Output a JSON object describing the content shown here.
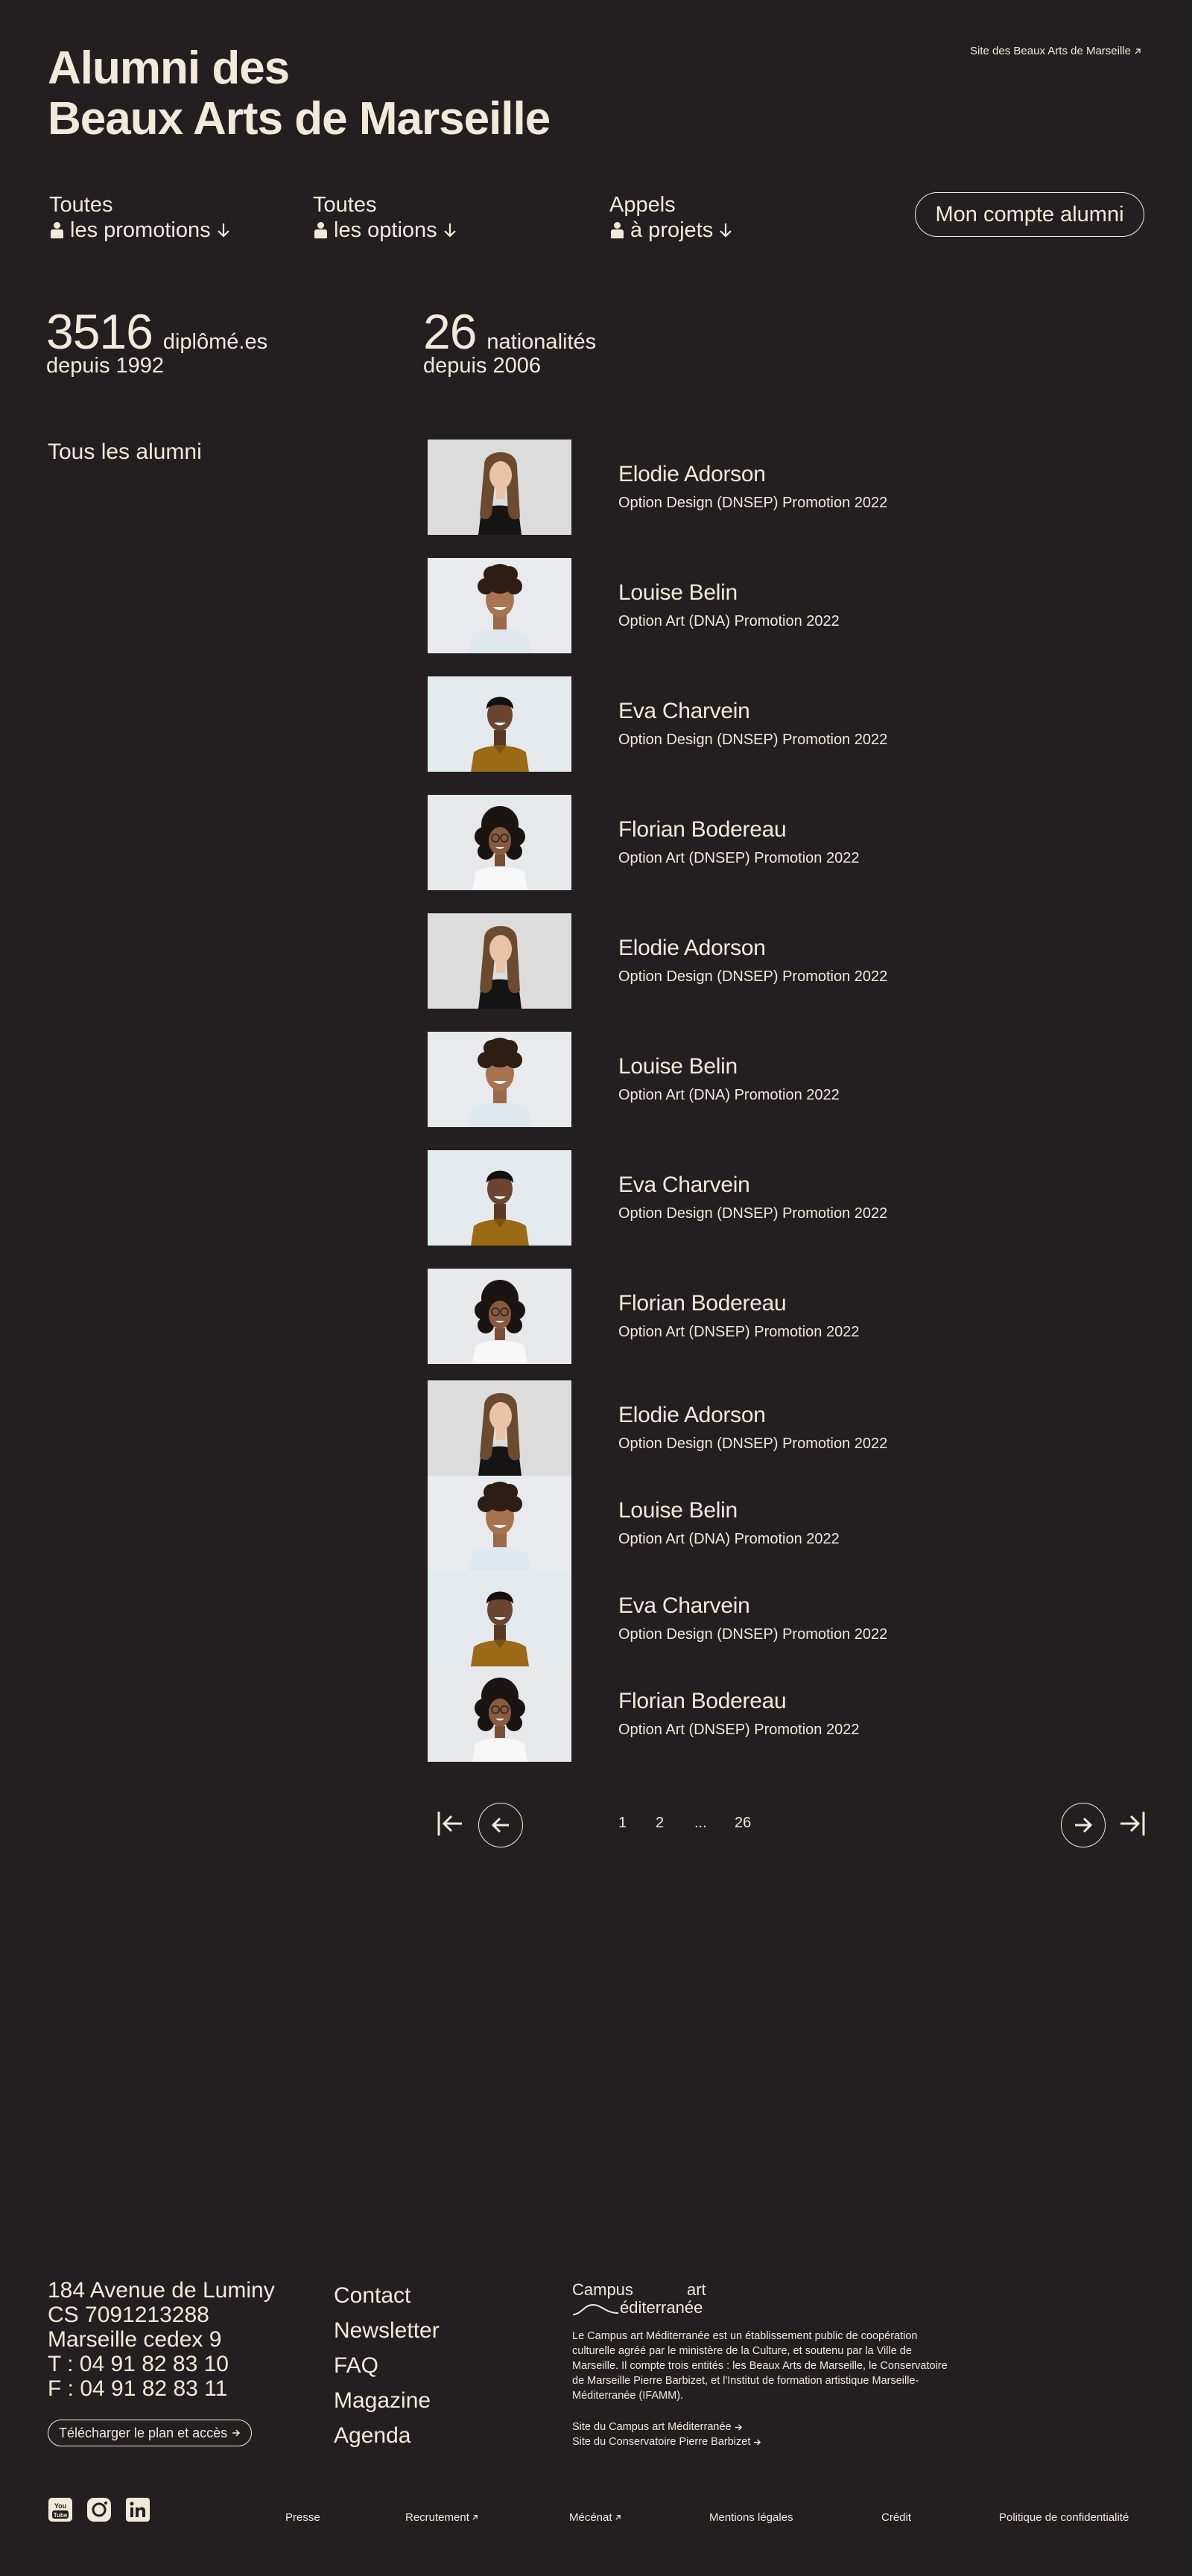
{
  "header": {
    "site_link": "Site des Beaux Arts de Marseille",
    "title_line1": "Alumni des",
    "title_line2": "Beaux Arts de Marseille"
  },
  "filters": [
    {
      "line1": "Toutes",
      "line2": "les promotions"
    },
    {
      "line1": "Toutes",
      "line2": "les options"
    },
    {
      "line1": "Appels",
      "line2": "à projets"
    }
  ],
  "account_button": "Mon compte alumni",
  "stats": [
    {
      "number": "3516",
      "label": "diplômé.es",
      "since": "depuis 1992"
    },
    {
      "number": "26",
      "label": "nationalités",
      "since": "depuis 2006"
    }
  ],
  "section_label": "Tous les alumni",
  "alumni": [
    {
      "name": "Elodie Adorson",
      "info": "Option Design (DNSEP) Promotion 2022",
      "photo": "woman-long-hair"
    },
    {
      "name": "Louise Belin",
      "info": "Option Art (DNA) Promotion 2022",
      "photo": "man-curly-hair"
    },
    {
      "name": "Eva Charvein",
      "info": "Option Design (DNSEP) Promotion 2022",
      "photo": "man-mustard-shirt"
    },
    {
      "name": "Florian Bodereau",
      "info": "Option Art (DNSEP) Promotion 2022",
      "photo": "woman-curly-glasses"
    },
    {
      "name": "Elodie Adorson",
      "info": "Option Design (DNSEP) Promotion 2022",
      "photo": "woman-long-hair"
    },
    {
      "name": "Louise Belin",
      "info": "Option Art (DNA) Promotion 2022",
      "photo": "man-curly-hair"
    },
    {
      "name": "Eva Charvein",
      "info": "Option Design (DNSEP) Promotion 2022",
      "photo": "man-mustard-shirt"
    },
    {
      "name": "Florian Bodereau",
      "info": "Option Art (DNSEP) Promotion 2022",
      "photo": "woman-curly-glasses"
    },
    {
      "name": "Elodie Adorson",
      "info": "Option Design (DNSEP) Promotion 2022",
      "photo": "woman-long-hair"
    },
    {
      "name": "Louise Belin",
      "info": "Option Art (DNA) Promotion 2022",
      "photo": "man-curly-hair"
    },
    {
      "name": "Eva Charvein",
      "info": "Option Design (DNSEP) Promotion 2022",
      "photo": "man-mustard-shirt"
    },
    {
      "name": "Florian Bodereau",
      "info": "Option Art (DNSEP) Promotion 2022",
      "photo": "woman-curly-glasses"
    }
  ],
  "pagination": {
    "pages": [
      "1",
      "2",
      "...",
      "26"
    ]
  },
  "footer": {
    "address": [
      "184 Avenue de Luminy",
      "CS 7091213288",
      "Marseille cedex 9",
      "T : 04 91 82 83 10",
      "F : 04 91 82 83 11"
    ],
    "plan_button": "Télécharger le plan et accès",
    "nav": [
      "Contact",
      "Newsletter",
      "FAQ",
      "Magazine",
      "Agenda"
    ],
    "campus_logo": {
      "word1": "Campus",
      "word2": "art",
      "word3": "éditerranée"
    },
    "campus_text": "Le Campus art Méditerranée est un établissement public de coopération culturelle agréé par le ministère de la Culture, et soutenu par la Ville de Marseille. Il compte trois entités : les Beaux Arts de Marseille, le Conservatoire de Marseille Pierre Barbizet, et l'Institut de formation artistique Marseille-Méditerranée (IFAMM).",
    "campus_links": [
      "Site du Campus art Méditerranée",
      "Site du Conservatoire Pierre Barbizet"
    ],
    "social_icons": [
      "youtube-icon",
      "instagram-icon",
      "linkedin-icon"
    ],
    "bottom_links": [
      "Presse",
      "Recrutement",
      "Mécénat",
      "Mentions légales",
      "Crédit",
      "Politique de confidentialité"
    ]
  },
  "colors": {
    "background": "#231f20",
    "foreground": "#f2ead9",
    "photo_bg": "#e4e6e8"
  }
}
